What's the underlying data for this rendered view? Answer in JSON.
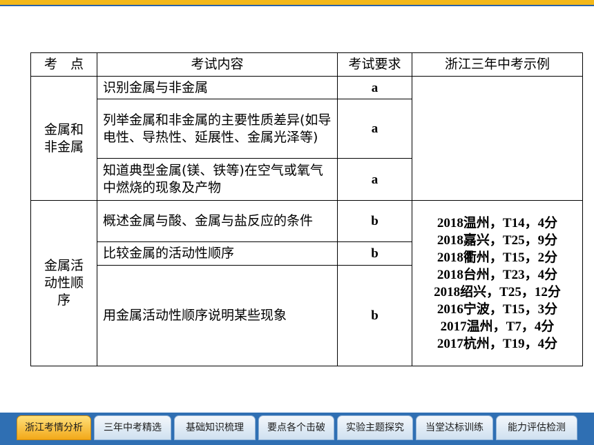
{
  "table": {
    "headers": [
      "考　点",
      "考试内容",
      "考试要求",
      "浙江三年中考示例"
    ],
    "groups": [
      {
        "topic": "金属和非金属",
        "rows": [
          {
            "content": "识别金属与非金属",
            "req": "a"
          },
          {
            "content": "列举金属和非金属的主要性质差异(如导电性、导热性、延展性、金属光泽等)",
            "req": "a"
          },
          {
            "content": "知道典型金属(镁、铁等)在空气或氧气中燃烧的现象及产物",
            "req": "a"
          }
        ],
        "examples": []
      },
      {
        "topic": "金属活动性顺序",
        "rows": [
          {
            "content": "概述金属与酸、金属与盐反应的条件",
            "req": "b"
          },
          {
            "content": "比较金属的活动性顺序",
            "req": "b"
          },
          {
            "content": "用金属活动性顺序说明某些现象",
            "req": "b"
          }
        ],
        "examples": [
          "2018温州，T14，4分",
          "2018嘉兴，T25，9分",
          "2018衢州，T15，2分",
          "2018台州，T23，4分",
          "2018绍兴，T25，12分",
          "2016宁波，T15，3分",
          "2017温州，T7，4分",
          "2017杭州，T19，4分"
        ]
      }
    ]
  },
  "nav": {
    "tabs": [
      "浙江考情分析",
      "三年中考精选",
      "基础知识梳理",
      "要点各个击破",
      "实验主题探究",
      "当堂达标训练",
      "能力评估检测"
    ],
    "active": 0
  },
  "colors": {
    "top_bar": "#f3b81a",
    "bottom_bar": "#2f6fb3",
    "active_tab": "#f2a819"
  }
}
